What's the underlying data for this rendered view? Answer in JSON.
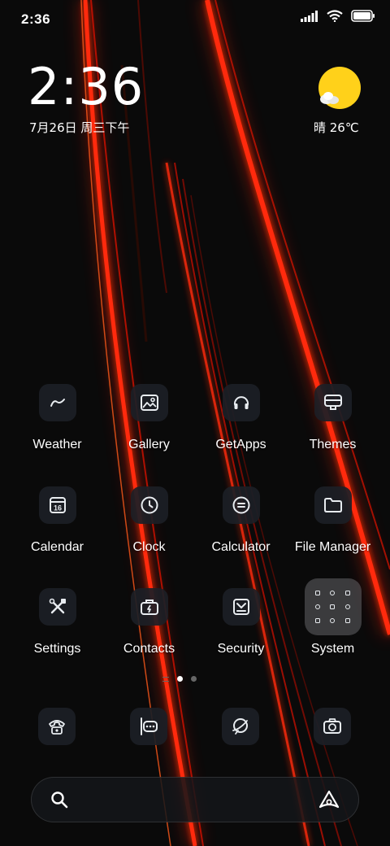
{
  "status_bar": {
    "time": "2:36",
    "icons": [
      "signal-icon",
      "wifi-icon",
      "battery-icon"
    ]
  },
  "clock_widget": {
    "time": "2:36",
    "date": "7月26日 周三下午"
  },
  "weather_widget": {
    "icon": "sunny-cloud-icon",
    "text": "晴 26℃"
  },
  "apps": [
    {
      "label": "Weather",
      "icon": "weather-icon"
    },
    {
      "label": "Gallery",
      "icon": "gallery-icon"
    },
    {
      "label": "GetApps",
      "icon": "getapps-icon"
    },
    {
      "label": "Themes",
      "icon": "themes-icon"
    },
    {
      "label": "Calendar",
      "icon": "calendar-icon",
      "icon_text": "16"
    },
    {
      "label": "Clock",
      "icon": "clock-icon"
    },
    {
      "label": "Calculator",
      "icon": "calculator-icon"
    },
    {
      "label": "File Manager",
      "icon": "folder-icon"
    },
    {
      "label": "Settings",
      "icon": "settings-icon"
    },
    {
      "label": "Contacts",
      "icon": "contacts-icon"
    },
    {
      "label": "Security",
      "icon": "security-icon"
    },
    {
      "label": "System",
      "icon": "system-folder-icon"
    }
  ],
  "page_indicator": {
    "pages": 2,
    "active": 0
  },
  "dock": [
    {
      "icon": "phone-icon"
    },
    {
      "icon": "messages-icon"
    },
    {
      "icon": "browser-icon"
    },
    {
      "icon": "camera-icon"
    }
  ],
  "search_bar": {
    "left_icon": "search-icon",
    "right_icon": "assistant-icon"
  },
  "colors": {
    "background": "#0a0a0a",
    "streak_red": "#ff1a05",
    "sun_yellow": "#ffd11a",
    "icon_tile": "#1c2026",
    "icon_stroke": "#e8ecf0"
  }
}
